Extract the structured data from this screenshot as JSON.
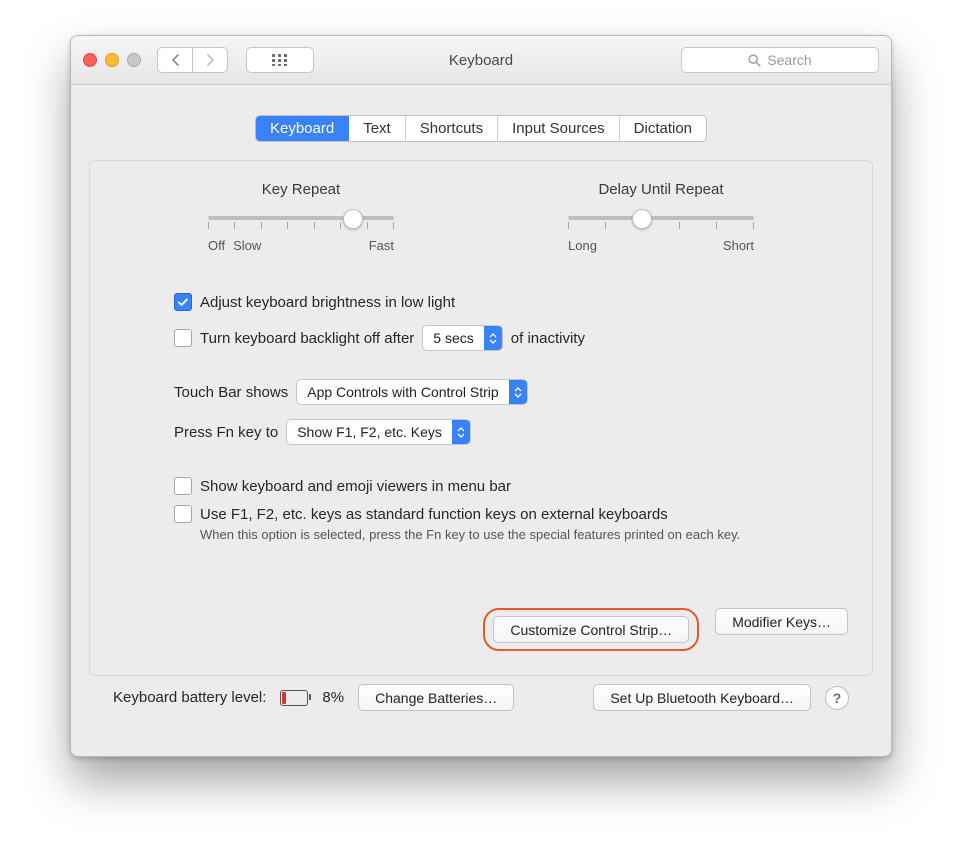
{
  "window": {
    "title": "Keyboard",
    "search_placeholder": "Search"
  },
  "tabs": [
    "Keyboard",
    "Text",
    "Shortcuts",
    "Input Sources",
    "Dictation"
  ],
  "sliders": {
    "key_repeat": {
      "title": "Key Repeat",
      "left1": "Off",
      "left2": "Slow",
      "right": "Fast"
    },
    "delay": {
      "title": "Delay Until Repeat",
      "left": "Long",
      "right": "Short"
    }
  },
  "options": {
    "auto_brightness": "Adjust keyboard brightness in low light",
    "backlight_off": {
      "pre": "Turn keyboard backlight off after",
      "value": "5 secs",
      "post": "of inactivity"
    },
    "touchbar": {
      "label": "Touch Bar shows",
      "value": "App Controls with Control Strip"
    },
    "fn": {
      "label": "Press Fn key to",
      "value": "Show F1, F2, etc. Keys"
    },
    "show_viewers": "Show keyboard and emoji viewers in menu bar",
    "std_fn": {
      "label": "Use F1, F2, etc. keys as standard function keys on external keyboards",
      "help": "When this option is selected, press the Fn key to use the special features printed on each key."
    }
  },
  "buttons": {
    "customize": "Customize Control Strip…",
    "modifier": "Modifier Keys…"
  },
  "footer": {
    "battery_label": "Keyboard battery level:",
    "battery_pct": "8%",
    "change_batt": "Change Batteries…",
    "bt_setup": "Set Up Bluetooth Keyboard…",
    "help": "?"
  }
}
